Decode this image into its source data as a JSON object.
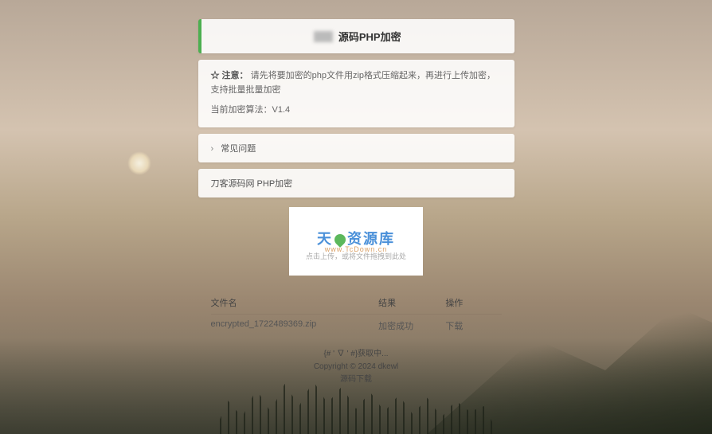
{
  "header": {
    "title_suffix": "源码PHP加密"
  },
  "notice": {
    "prefix": "☆ 注意：",
    "text": "请先将要加密的php文件用zip格式压缩起来，再进行上传加密，支持批量批量加密",
    "algo": "当前加密算法：V1.4"
  },
  "faq": {
    "label": "常见问题"
  },
  "section": {
    "label": "刀客源码网 PHP加密"
  },
  "upload": {
    "watermark_main": "天 资源库",
    "watermark_sub": "www.TcDown.cn",
    "hint": "点击上传，或将文件拖拽到此处"
  },
  "table": {
    "cols": {
      "file": "文件名",
      "result": "结果",
      "action": "操作"
    },
    "row": {
      "file": "encrypted_1722489369.zip",
      "result": "加密成功",
      "action": "下载"
    }
  },
  "footer": {
    "hitokoto": "{# ' ∇ ' #}获取中...",
    "copyright": "Copyright © 2024 dkewl",
    "link": "源码下载"
  }
}
